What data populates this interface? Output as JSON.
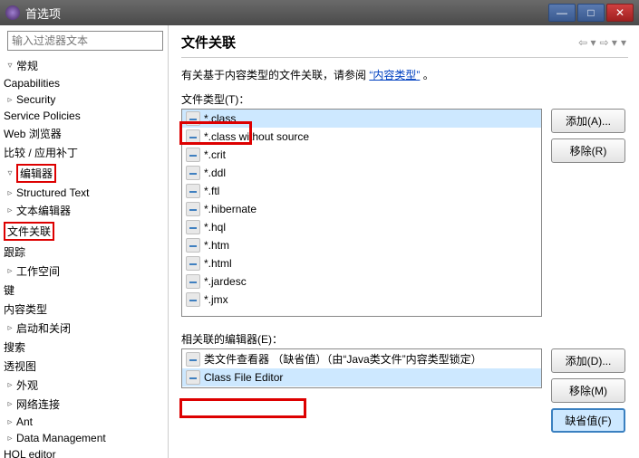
{
  "window": {
    "title": "首选项"
  },
  "filter": {
    "placeholder": "输入过滤器文本"
  },
  "tree": {
    "general": "常规",
    "capabilities": "Capabilities",
    "security": "Security",
    "service_policies": "Service Policies",
    "web_browser": "Web 浏览器",
    "compare_patch": "比较 / 应用补丁",
    "editors": "编辑器",
    "structured_text": "Structured Text",
    "text_editors": "文本编辑器",
    "file_associations": "文件关联",
    "tracing": "跟踪",
    "workspace": "工作空间",
    "keys": "键",
    "content_types": "内容类型",
    "startup_shutdown": "启动和关闭",
    "search": "搜索",
    "perspectives": "透视图",
    "appearance": "外观",
    "network": "网络连接",
    "ant": "Ant",
    "data_management": "Data Management",
    "hql_editor": "HQL editor"
  },
  "heading": {
    "title": "文件关联"
  },
  "desc": {
    "prefix": "有关基于内容类型的文件关联，请参阅",
    "link": "“内容类型”",
    "suffix": "。"
  },
  "labels": {
    "file_types": "文件类型(T)：",
    "associated_editors": "相关联的编辑器(E)："
  },
  "file_types": [
    "*.class",
    "*.class without source",
    "*.crit",
    "*.ddl",
    "*.ftl",
    "*.hibernate",
    "*.hql",
    "*.htm",
    "*.html",
    "*.jardesc",
    "*.jmx"
  ],
  "editors_list": {
    "default_viewer": "类文件查看器 （缺省值）（由“Java类文件”内容类型锁定）",
    "class_file_editor": "Class File Editor"
  },
  "buttons": {
    "add_a": "添加(A)...",
    "remove_r": "移除(R)",
    "add_d": "添加(D)...",
    "remove_m": "移除(M)",
    "default_f": "缺省值(F)"
  }
}
